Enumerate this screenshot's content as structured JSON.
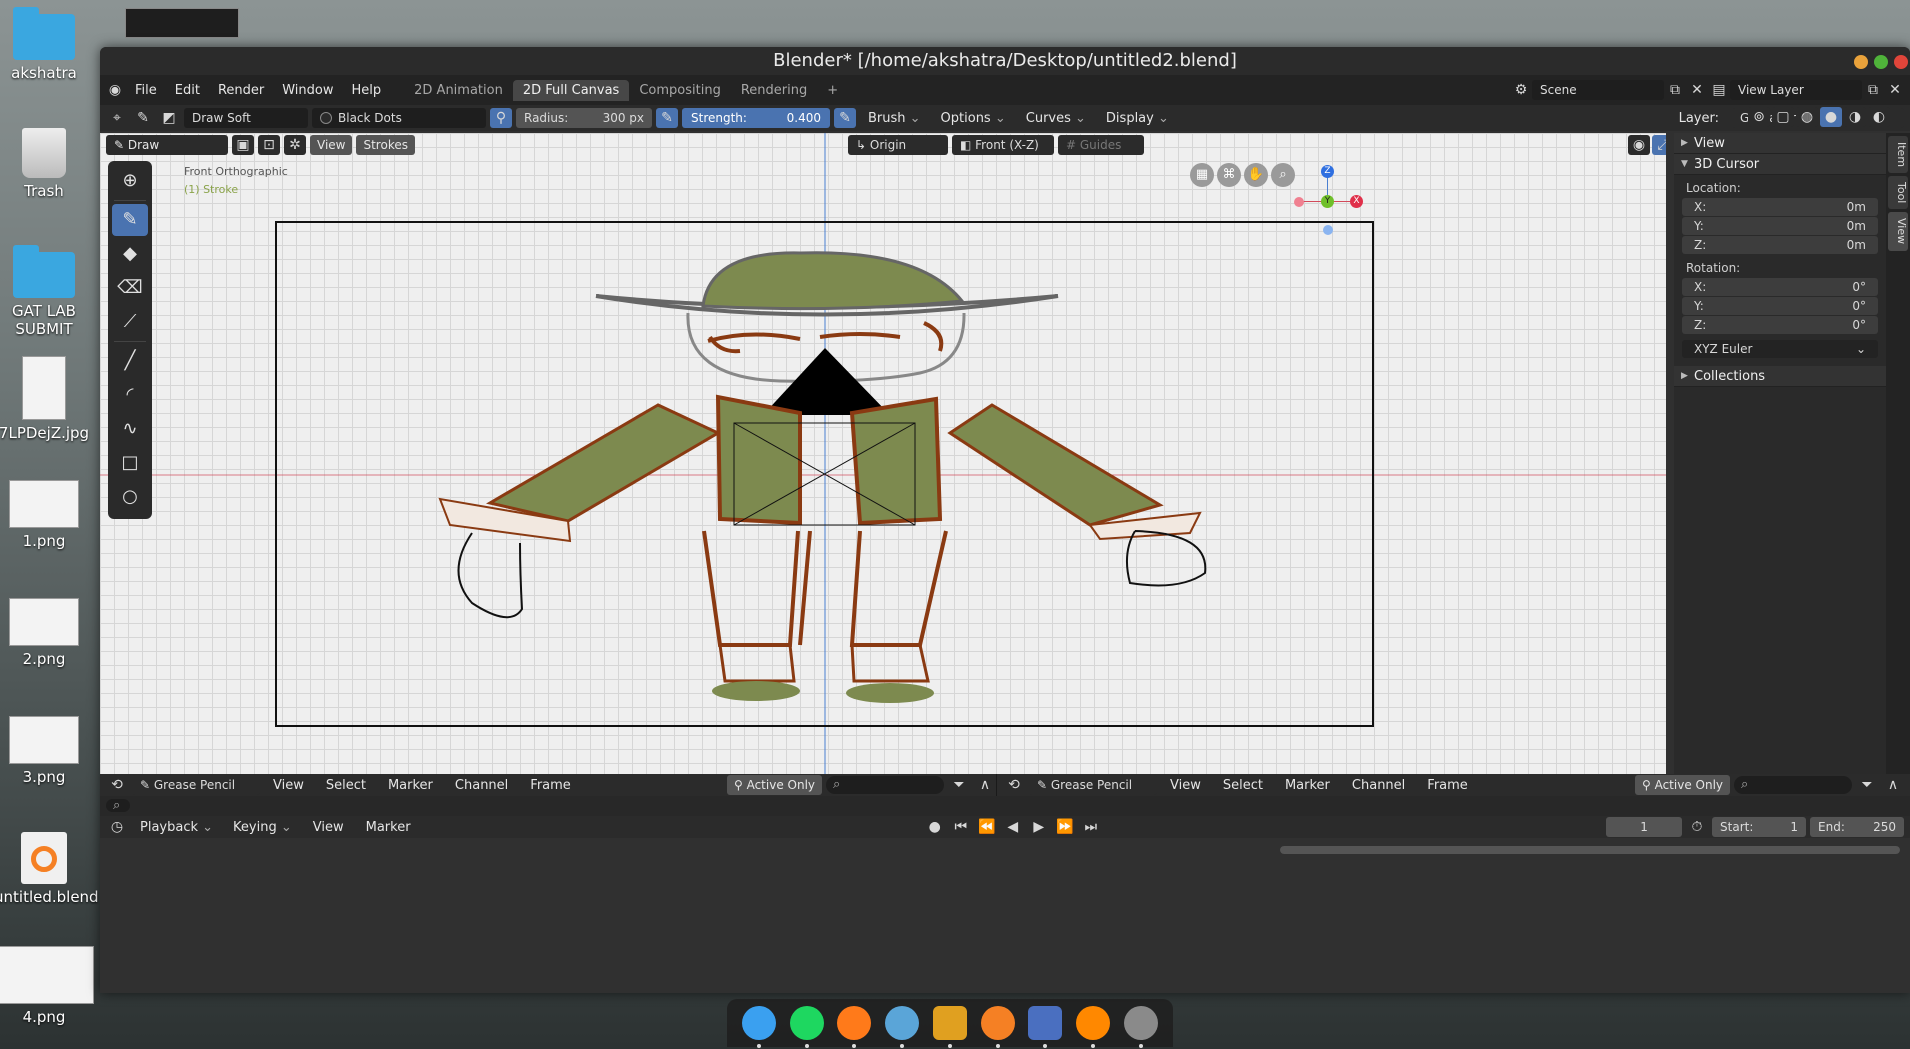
{
  "desktop": {
    "icons": [
      {
        "label": "akshatra",
        "kind": "folder"
      },
      {
        "label": "Trash",
        "kind": "trash"
      },
      {
        "label": "GAT LAB SUBMIT",
        "kind": "folder"
      },
      {
        "label": "7LPDejZ.jpg",
        "kind": "image"
      },
      {
        "label": "1.png",
        "kind": "image"
      },
      {
        "label": "2.png",
        "kind": "image"
      },
      {
        "label": "3.png",
        "kind": "image"
      },
      {
        "label": "untitled.blend",
        "kind": "blend"
      },
      {
        "label": "4.png",
        "kind": "image"
      }
    ]
  },
  "window": {
    "title": "Blender* [/home/akshatra/Desktop/untitled2.blend]",
    "buttons": {
      "minimize": "#e9a23b",
      "maximize": "#4fb33a",
      "close": "#e0453a"
    }
  },
  "topbar": {
    "menus": [
      "File",
      "Edit",
      "Render",
      "Window",
      "Help"
    ],
    "workspaces": [
      "2D Animation",
      "2D Full Canvas",
      "Compositing",
      "Rendering"
    ],
    "active_workspace": "2D Full Canvas",
    "add_tab": "+",
    "scene": "Scene",
    "view_layer": "View Layer"
  },
  "tool_header": {
    "brush": "Draw Soft",
    "material": "Black Dots",
    "radius_label": "Radius:",
    "radius_value": "300 px",
    "strength_label": "Strength:",
    "strength_value": "0.400",
    "menus": [
      "Brush",
      "Options",
      "Curves",
      "Display"
    ],
    "layer_label": "Layer:",
    "layer_value": "GP_Layer"
  },
  "viewport_header": {
    "mode": "Draw",
    "view": "View",
    "strokes": "Strokes",
    "pivot": "Origin",
    "orientation": "Front (X-Z)",
    "guides": "Guides"
  },
  "viewport": {
    "view_name": "Front Orthographic",
    "object_info": "(1) Stroke",
    "gizmo_axes": [
      "Z",
      "Y",
      "X"
    ]
  },
  "tools": [
    {
      "name": "cursor-tool",
      "glyph": "⊕",
      "active": false
    },
    {
      "name": "draw-tool",
      "glyph": "✎",
      "active": true
    },
    {
      "name": "fill-tool",
      "glyph": "◆",
      "active": false
    },
    {
      "name": "erase-tool",
      "glyph": "⌫",
      "active": false
    },
    {
      "name": "tint-tool",
      "glyph": "⟋",
      "active": false
    },
    {
      "name": "line-tool",
      "glyph": "╱",
      "active": false
    },
    {
      "name": "arc-tool",
      "glyph": "◜",
      "active": false
    },
    {
      "name": "curve-tool",
      "glyph": "∿",
      "active": false
    },
    {
      "name": "box-tool",
      "glyph": "□",
      "active": false
    },
    {
      "name": "circle-tool",
      "glyph": "○",
      "active": false
    }
  ],
  "npanel": {
    "view": "View",
    "cursor_panel": "3D Cursor",
    "location_label": "Location:",
    "location": [
      {
        "axis": "X:",
        "value": "0m"
      },
      {
        "axis": "Y:",
        "value": "0m"
      },
      {
        "axis": "Z:",
        "value": "0m"
      }
    ],
    "rotation_label": "Rotation:",
    "rotation": [
      {
        "axis": "X:",
        "value": "0°"
      },
      {
        "axis": "Y:",
        "value": "0°"
      },
      {
        "axis": "Z:",
        "value": "0°"
      }
    ],
    "rotation_mode": "XYZ Euler",
    "collections": "Collections",
    "side_tabs": [
      "Item",
      "Tool",
      "View"
    ]
  },
  "dopesheet": {
    "mode": "Grease Pencil",
    "menus": [
      "View",
      "Select",
      "Marker",
      "Channel",
      "Frame"
    ],
    "active_only": "Active Only"
  },
  "timeline": {
    "menus": [
      "Playback",
      "Keying",
      "View",
      "Marker"
    ],
    "current_frame": "1",
    "start_label": "Start:",
    "start": "1",
    "end_label": "End:",
    "end": "250"
  },
  "dock": [
    "finder",
    "spotify",
    "firefox",
    "chromium",
    "micro",
    "blender",
    "files",
    "vlc",
    "launchpad"
  ],
  "colors": {
    "accent": "#4a73b0",
    "jacket": "#7d8a4f",
    "outline_brown": "#8a3a12",
    "axis_red": "#d24a5a",
    "axis_blue": "#4a7fd0"
  }
}
